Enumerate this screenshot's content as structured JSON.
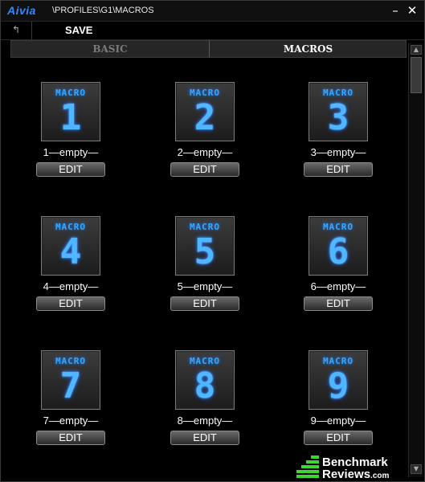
{
  "titlebar": {
    "logo": "Aivia",
    "path": "\\PROFILES\\G1\\MACROS",
    "minimize": "–",
    "close": "✕"
  },
  "toolbar": {
    "back": "↰",
    "save_label": "SAVE"
  },
  "tabs": [
    {
      "label": "BASIC",
      "active": false
    },
    {
      "label": "MACROS",
      "active": true
    }
  ],
  "macros": [
    {
      "tile_label": "MACRO",
      "number": "1",
      "name": "1—empty—",
      "edit": "EDIT"
    },
    {
      "tile_label": "MACRO",
      "number": "2",
      "name": "2—empty—",
      "edit": "EDIT"
    },
    {
      "tile_label": "MACRO",
      "number": "3",
      "name": "3—empty—",
      "edit": "EDIT"
    },
    {
      "tile_label": "MACRO",
      "number": "4",
      "name": "4—empty—",
      "edit": "EDIT"
    },
    {
      "tile_label": "MACRO",
      "number": "5",
      "name": "5—empty—",
      "edit": "EDIT"
    },
    {
      "tile_label": "MACRO",
      "number": "6",
      "name": "6—empty—",
      "edit": "EDIT"
    },
    {
      "tile_label": "MACRO",
      "number": "7",
      "name": "7—empty—",
      "edit": "EDIT"
    },
    {
      "tile_label": "MACRO",
      "number": "8",
      "name": "8—empty—",
      "edit": "EDIT"
    },
    {
      "tile_label": "MACRO",
      "number": "9",
      "name": "9—empty—",
      "edit": "EDIT"
    }
  ],
  "scrollbar": {
    "up": "▲",
    "down": "▼"
  },
  "watermark": {
    "line1": "Benchmark",
    "line2": "Reviews",
    "suffix": ".com"
  },
  "colors": {
    "accent": "#34a8ff",
    "background": "#000000",
    "watermark_green": "#3bd62f"
  }
}
